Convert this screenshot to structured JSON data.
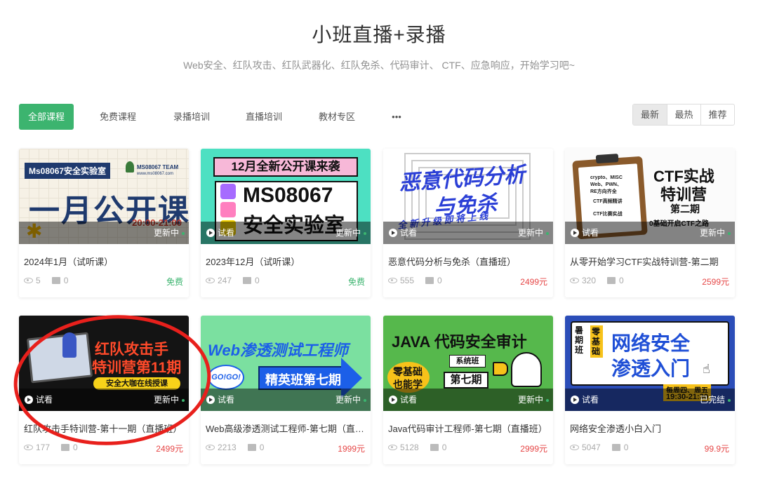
{
  "header": {
    "title": "小班直播+录播",
    "subtitle": "Web安全、红队攻击、红队武器化、红队免杀、代码审计、 CTF、应急响应，开始学习吧~"
  },
  "tabs": [
    "全部课程",
    "免费课程",
    "录播培训",
    "直播培训",
    "教材专区",
    "•••"
  ],
  "sort": [
    "最新",
    "最热",
    "推荐"
  ],
  "courses": [
    {
      "title": "2024年1月（试听课）",
      "views": "5",
      "comments": "0",
      "price": "免费",
      "free": true,
      "status": "更新中",
      "trial": "",
      "thumb": {
        "label": "Ms08067安全实验室",
        "team": "MS08067 TEAM",
        "url": "www.ms08067.com",
        "big": "一月公开课",
        "time": "20:00-21:00"
      }
    },
    {
      "title": "2023年12月（试听课）",
      "views": "247",
      "comments": "0",
      "price": "免费",
      "free": true,
      "status": "更新中",
      "trial": "试看",
      "thumb": {
        "top": "12月全新公开课来袭",
        "l1": "MS08067",
        "l2": "安全实验室"
      }
    },
    {
      "title": "恶意代码分析与免杀（直播班）",
      "views": "555",
      "comments": "0",
      "price": "2499元",
      "free": false,
      "status": "更新中",
      "trial": "试看",
      "thumb": {
        "l1": "恶意代码分析",
        "l2": "与免杀",
        "sub": "全 新 升 级  即 将 上 线"
      }
    },
    {
      "title": "从零开始学习CTF实战特训营-第二期",
      "views": "320",
      "comments": "0",
      "price": "2599元",
      "free": false,
      "status": "更新中",
      "trial": "试看",
      "thumb": {
        "l1": "CTF实战",
        "l2": "特训营",
        "l3": "第二期",
        "l4": "0基础开启CTF之路",
        "c1": "crypto、MISC",
        "c2": "Web、PWN、",
        "c3": "RE方向齐全",
        "c4": "CTF高频精讲",
        "c5": "CTF比赛实战"
      }
    },
    {
      "title": "红队攻击手特训营-第十一期（直播班）",
      "views": "177",
      "comments": "0",
      "price": "2499元",
      "free": false,
      "status": "更新中",
      "trial": "试看",
      "thumb": {
        "l1": "红队攻击手",
        "l2": "特训营第11期",
        "l3": "安全大咖在线授课"
      }
    },
    {
      "title": "Web高级渗透测试工程师-第七期（直播班）",
      "views": "2213",
      "comments": "0",
      "price": "1999元",
      "free": false,
      "status": "更新中",
      "trial": "试看",
      "thumb": {
        "l1": "Web渗透测试工程师",
        "l2": "GO!GO!",
        "l3": "精英班第七期"
      }
    },
    {
      "title": "Java代码审计工程师-第七期（直播班）",
      "views": "5128",
      "comments": "0",
      "price": "2999元",
      "free": false,
      "status": "更新中",
      "trial": "试看",
      "thumb": {
        "l1": "JAVA 代码安全审计",
        "l2": "零基础",
        "l3": "也能学",
        "l4": "系统班",
        "l5": "第七期"
      }
    },
    {
      "title": "网络安全渗透小白入门",
      "views": "5047",
      "comments": "0",
      "price": "99.9元",
      "free": false,
      "status": "已完结",
      "trial": "试看",
      "thumb": {
        "l1": "网络安全",
        "l2": "渗透入门",
        "l3": "暑期班",
        "l4": "零基础",
        "l5": "每周四、周五",
        "l6": "19:30-21:30"
      }
    }
  ],
  "colors": {
    "accent": "#3cb46f",
    "price": "#e64646",
    "annotation": "#e8201c"
  }
}
